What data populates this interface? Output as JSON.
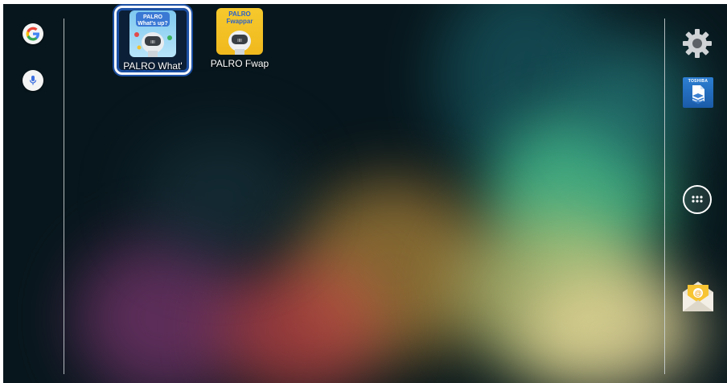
{
  "apps": [
    {
      "label": "PALRO What'",
      "icon_name": "palro-whatsup-icon",
      "icon_text": [
        "PALRO",
        "What's up?"
      ],
      "selected": true
    },
    {
      "label": "PALRO Fwap",
      "icon_name": "palro-fwappar-icon",
      "icon_text": [
        "PALRO",
        "Fwappar"
      ],
      "selected": false
    }
  ],
  "left_bar": {
    "items": [
      "google-search-icon",
      "voice-search-icon"
    ]
  },
  "right_bar": {
    "items": [
      "settings-icon",
      "toshiba-file-icon",
      "app-drawer-icon",
      "email-icon"
    ],
    "toshiba_text": "TOSHIBA"
  },
  "colors": {
    "selection": "#1b4fa3",
    "palro_blue": "#8fd0f0",
    "palro_yellow": "#f5c52a"
  }
}
